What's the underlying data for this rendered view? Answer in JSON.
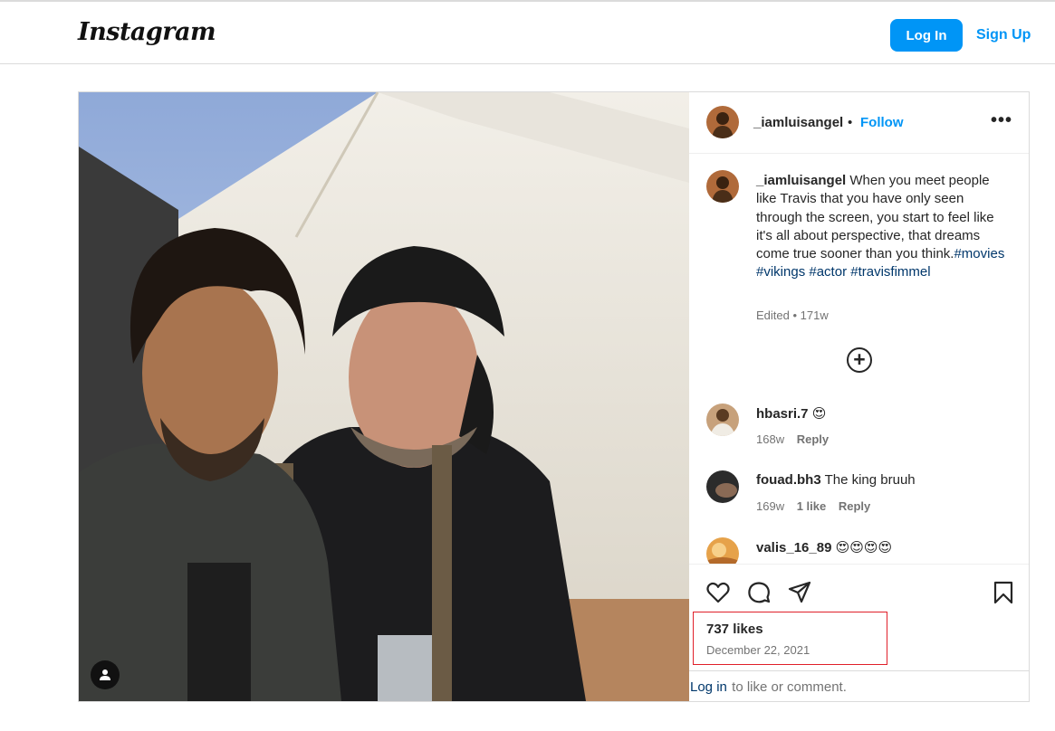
{
  "header": {
    "logo_text": "Instagram",
    "login_label": "Log In",
    "signup_label": "Sign Up"
  },
  "post": {
    "author": "_iamluisangel",
    "follow_label": "Follow",
    "separator": "•",
    "more_label": "•••",
    "caption_text": "When you meet people like Travis that you have only seen through the screen, you start to feel like it's all about perspective, that dreams come true sooner than you think.",
    "hashtags": [
      "#movies",
      "#vikings",
      "#actor",
      "#travisfimmel"
    ],
    "caption_meta": "Edited • 171w",
    "load_more_label": "+",
    "comments": [
      {
        "user": "hbasri.7",
        "text": "😍",
        "age": "168w",
        "likes": "",
        "reply": "Reply"
      },
      {
        "user": "fouad.bh3",
        "text": "The king bruuh",
        "age": "169w",
        "likes": "1 like",
        "reply": "Reply"
      },
      {
        "user": "valis_16_89",
        "text": "😍😍😍😍",
        "age": "",
        "likes": "",
        "reply": ""
      }
    ],
    "likes_text": "737 likes",
    "date_text": "December 22, 2021",
    "login_link": "Log in",
    "login_rest": " to like or comment."
  },
  "icons": [
    "heart-icon",
    "comment-icon",
    "share-icon",
    "bookmark-icon",
    "user-tag-icon",
    "plus-circle-icon",
    "more-icon"
  ],
  "colors": {
    "accent": "#0095f6",
    "hashtag": "#00376b",
    "highlight": "#e0202a"
  }
}
